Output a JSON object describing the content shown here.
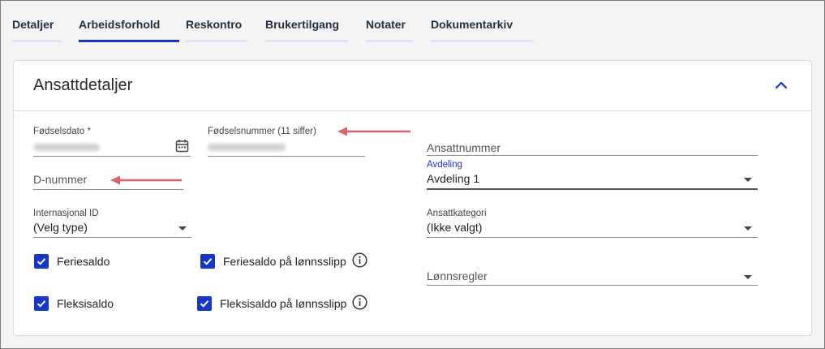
{
  "tabs": [
    {
      "label": "Detaljer",
      "active": false
    },
    {
      "label": "Arbeidsforhold",
      "active": true
    },
    {
      "label": "Reskontro",
      "active": false
    },
    {
      "label": "Brukertilgang",
      "active": false
    },
    {
      "label": "Notater",
      "active": false
    },
    {
      "label": "Dokumentarkiv",
      "active": false
    }
  ],
  "card": {
    "title": "Ansattdetaljer",
    "collapse_icon": "chevron-up-icon"
  },
  "form": {
    "birthdate": {
      "label": "Fødselsdato *",
      "value_redacted": true,
      "icon": "calendar-icon"
    },
    "ssn": {
      "label": "Fødselsnummer (11 siffer)",
      "value_redacted": true
    },
    "dnumber": {
      "placeholder": "D-nummer"
    },
    "employee_number": {
      "placeholder": "Ansattnummer"
    },
    "department": {
      "label": "Avdeling",
      "value": "Avdeling 1"
    },
    "international_id": {
      "label": "Internasjonal ID",
      "value": "(Velg type)"
    },
    "employee_category": {
      "label": "Ansattkategori",
      "value": "(Ikke valgt)"
    },
    "salary_rules": {
      "placeholder": "Lønnsregler"
    },
    "checkboxes": {
      "holiday_balance": {
        "label": "Feriesaldo",
        "checked": true
      },
      "holiday_balance_payslip": {
        "label": "Feriesaldo på lønnsslipp",
        "checked": true,
        "icon": "info-icon"
      },
      "flex_balance": {
        "label": "Fleksisaldo",
        "checked": true
      },
      "flex_balance_payslip": {
        "label": "Fleksisaldo på lønnsslipp",
        "checked": true,
        "icon": "info-icon"
      }
    }
  },
  "colors": {
    "accent": "#1536c8",
    "annotation_arrow": "#e0636b",
    "tab_underline_inactive": "#dde3f0"
  }
}
